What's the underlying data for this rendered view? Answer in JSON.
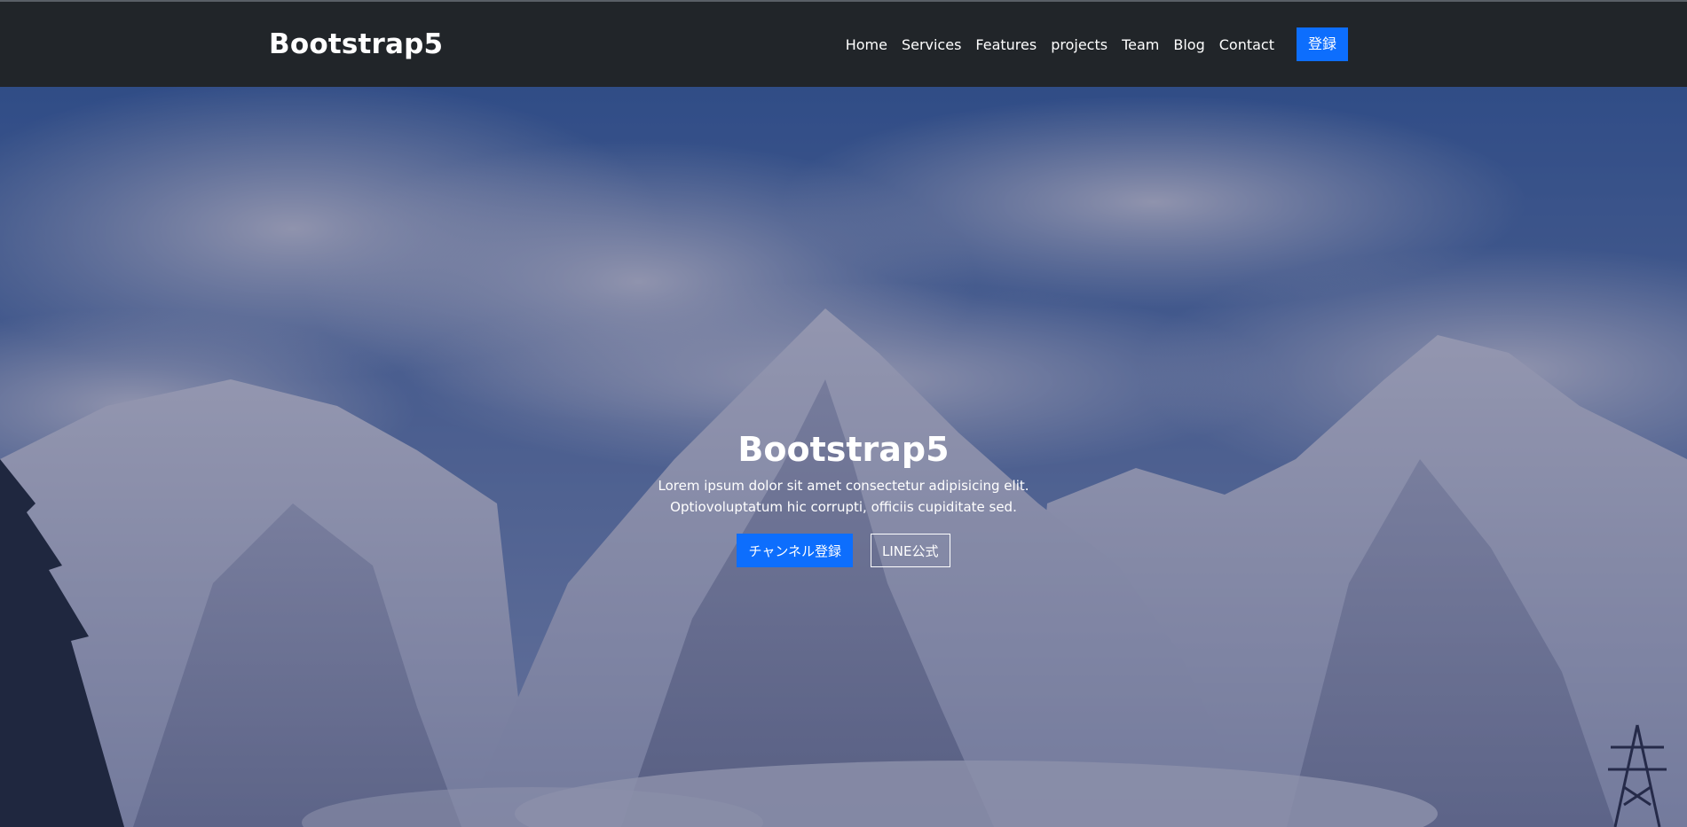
{
  "navbar": {
    "brand": "Bootstrap5",
    "links": [
      "Home",
      "Services",
      "Features",
      "projects",
      "Team",
      "Blog",
      "Contact"
    ],
    "register_label": "登録"
  },
  "hero": {
    "title": "Bootstrap5",
    "text_line1": "Lorem ipsum dolor sit amet consectetur adipisicing elit.",
    "text_line2": "Optiovoluptatum hic corrupti, officiis cupiditate sed.",
    "primary_button": "チャンネル登録",
    "secondary_button": "LINE公式",
    "background": "mountain-landscape-image"
  },
  "colors": {
    "navbar_bg": "#212529",
    "accent": "#0d6efd",
    "overlay": "#1e2355"
  }
}
